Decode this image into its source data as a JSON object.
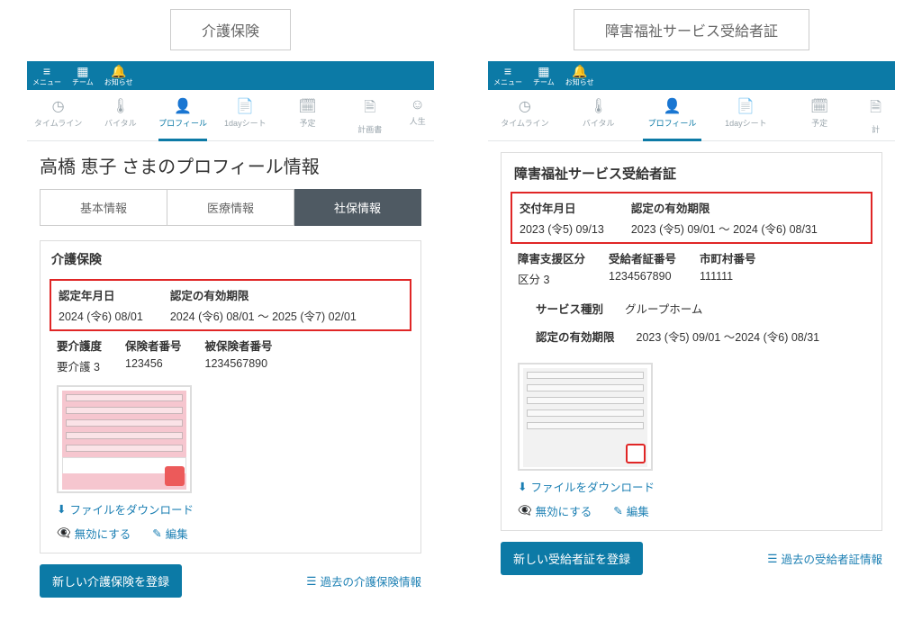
{
  "left": {
    "title_label": "介護保険",
    "topbar": {
      "menu": "メニュー",
      "team": "チーム",
      "notice": "お知らせ"
    },
    "tabs": {
      "timeline": "タイムライン",
      "vital": "バイタル",
      "profile": "プロフィール",
      "oneday": "1dayシート",
      "schedule": "予定",
      "plan": "計画書",
      "life": "人生"
    },
    "page_title": "高橋 恵子 さまのプロフィール情報",
    "subtabs": {
      "basic": "基本情報",
      "medical": "医療情報",
      "social": "社保情報"
    },
    "card_title": "介護保険",
    "cert_date": {
      "label": "認定年月日",
      "value": "2024 (令6) 08/01"
    },
    "valid_period": {
      "label": "認定の有効期限",
      "value": "2024 (令6) 08/01 ～ 2025 (令7) 02/01"
    },
    "care_level": {
      "label": "要介護度",
      "value": "要介護 3"
    },
    "insurer_no": {
      "label": "保険者番号",
      "value": "123456"
    },
    "insured_no": {
      "label": "被保険者番号",
      "value": "1234567890"
    },
    "download_link": "ファイルをダウンロード",
    "disable_action": "無効にする",
    "edit_action": "編集",
    "register_btn": "新しい介護保険を登録",
    "history_link": "過去の介護保険情報"
  },
  "right": {
    "title_label": "障害福祉サービス受給者証",
    "topbar": {
      "menu": "メニュー",
      "team": "チーム",
      "notice": "お知らせ"
    },
    "tabs": {
      "timeline": "タイムライン",
      "vital": "バイタル",
      "profile": "プロフィール",
      "oneday": "1dayシート",
      "schedule": "予定",
      "plan": "計"
    },
    "card_title": "障害福祉サービス受給者証",
    "issue_date": {
      "label": "交付年月日",
      "value": "2023 (令5) 09/13"
    },
    "valid_period": {
      "label": "認定の有効期限",
      "value": "2023 (令5) 09/01 ～ 2024 (令6) 08/31"
    },
    "support_cat": {
      "label": "障害支援区分",
      "value": "区分 3"
    },
    "cert_no": {
      "label": "受給者証番号",
      "value": "1234567890"
    },
    "city_no": {
      "label": "市町村番号",
      "value": "111111"
    },
    "service_type": {
      "label": "サービス種別",
      "value": "グループホーム"
    },
    "service_period": {
      "label": "認定の有効期限",
      "value": "2023 (令5) 09/01 ～2024 (令6) 08/31"
    },
    "download_link": "ファイルをダウンロード",
    "disable_action": "無効にする",
    "edit_action": "編集",
    "register_btn": "新しい受給者証を登録",
    "history_link": "過去の受給者証情報"
  }
}
